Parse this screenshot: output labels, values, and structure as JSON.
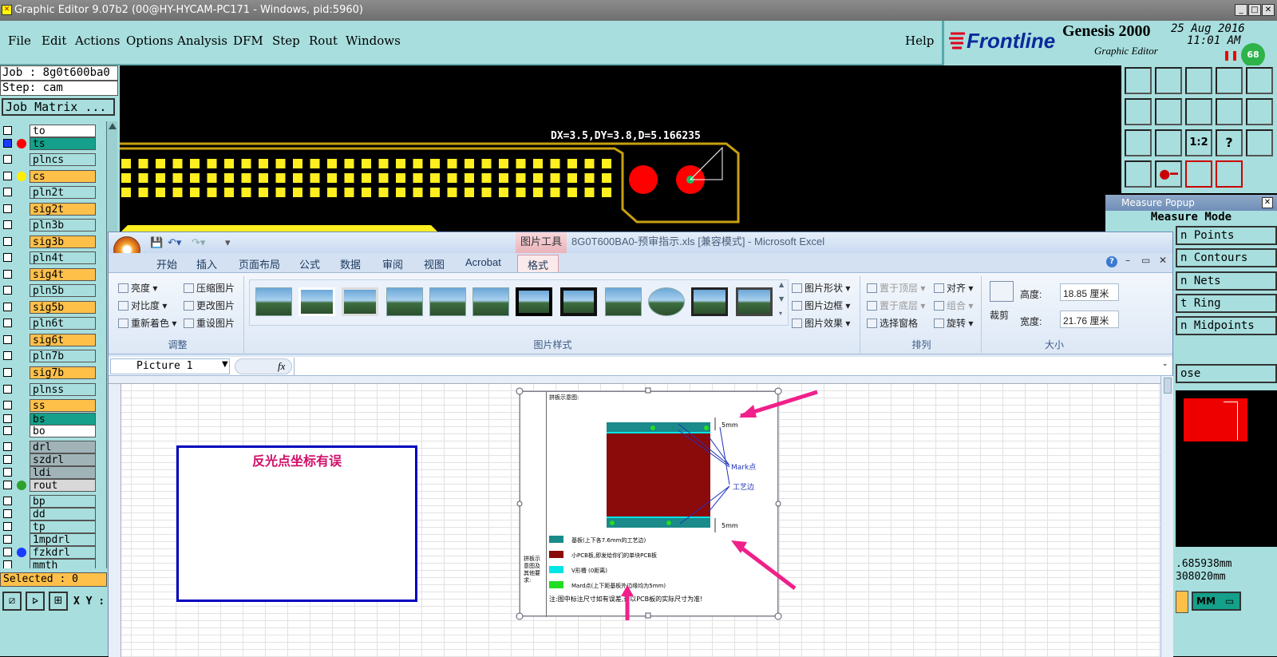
{
  "genesis": {
    "window_title": "Graphic Editor 9.07b2 (00@HY-HYCAM-PC171 - Windows, pid:5960)",
    "menu": [
      "File",
      "Edit",
      "Actions",
      "Options",
      "Analysis",
      "DFM",
      "Step",
      "Rout",
      "Windows"
    ],
    "help": "Help",
    "brand": "Frontline",
    "product": "Genesis 2000",
    "subtitle": "Graphic Editor",
    "date": "25 Aug 2016",
    "time": "11:01 AM",
    "badge": "68",
    "job": "Job : 8g0t600ba0",
    "step": "Step: cam",
    "job_matrix": "Job Matrix ...",
    "layers": [
      {
        "name": "to",
        "bg": "#ffffff",
        "dot": ""
      },
      {
        "name": "ts",
        "bg": "#14a08a",
        "dot": "#ff0000",
        "sel": true
      },
      {
        "name": "plncs",
        "bg": "#a8dede",
        "dot": ""
      },
      {
        "name": "cs",
        "bg": "#ffc04a",
        "dot": "#ffee00"
      },
      {
        "name": "pln2t",
        "bg": "#a8dede",
        "dot": ""
      },
      {
        "name": "sig2t",
        "bg": "#ffc04a",
        "dot": ""
      },
      {
        "name": "pln3b",
        "bg": "#a8dede",
        "dot": ""
      },
      {
        "name": "sig3b",
        "bg": "#ffc04a",
        "dot": ""
      },
      {
        "name": "pln4t",
        "bg": "#a8dede",
        "dot": ""
      },
      {
        "name": "sig4t",
        "bg": "#ffc04a",
        "dot": ""
      },
      {
        "name": "pln5b",
        "bg": "#a8dede",
        "dot": ""
      },
      {
        "name": "sig5b",
        "bg": "#ffc04a",
        "dot": ""
      },
      {
        "name": "pln6t",
        "bg": "#a8dede",
        "dot": ""
      },
      {
        "name": "sig6t",
        "bg": "#ffc04a",
        "dot": ""
      },
      {
        "name": "pln7b",
        "bg": "#a8dede",
        "dot": ""
      },
      {
        "name": "sig7b",
        "bg": "#ffc04a",
        "dot": ""
      },
      {
        "name": "plnss",
        "bg": "#a8dede",
        "dot": ""
      },
      {
        "name": "ss",
        "bg": "#ffc04a",
        "dot": ""
      },
      {
        "name": "bs",
        "bg": "#14a08a",
        "dot": ""
      },
      {
        "name": "bo",
        "bg": "#ffffff",
        "dot": ""
      },
      {
        "name": "drl",
        "bg": "#a0b4b8",
        "dot": ""
      },
      {
        "name": "szdrl",
        "bg": "#a0b4b8",
        "dot": ""
      },
      {
        "name": "ldi",
        "bg": "#a0b4b8",
        "dot": ""
      },
      {
        "name": "rout",
        "bg": "#d8d8d8",
        "dot": "#2ea02e"
      },
      {
        "name": "bp",
        "bg": "#a8dede",
        "dot": ""
      },
      {
        "name": "dd",
        "bg": "#a8dede",
        "dot": ""
      },
      {
        "name": "tp",
        "bg": "#a8dede",
        "dot": ""
      },
      {
        "name": "1mpdrl",
        "bg": "#a8dede",
        "dot": ""
      },
      {
        "name": "fzkdrl",
        "bg": "#a8dede",
        "dot": "#1a3cff"
      },
      {
        "name": "mmth",
        "bg": "#a8dede",
        "dot": ""
      }
    ],
    "selected": "Selected : 0",
    "xy_label": "X Y :",
    "measure_readout": "DX=3.5,DY=3.8,D=5.166235",
    "measure_popup": {
      "title": "Measure Popup",
      "mode": "Measure Mode",
      "buttons": [
        "n Points",
        "n Contours",
        "n Nets",
        "t Ring",
        "n Midpoints"
      ],
      "close": "ose",
      "val1": ".685938mm",
      "val2": "308020mm",
      "unit": "MM"
    }
  },
  "excel": {
    "title": "8G0T600BA0-预审指示.xls  [兼容模式] - Microsoft Excel",
    "context_tab": "图片工具",
    "tabs": [
      "开始",
      "插入",
      "页面布局",
      "公式",
      "数据",
      "审阅",
      "视图",
      "Acrobat",
      "格式"
    ],
    "adjust": {
      "items": [
        "亮度",
        "对比度",
        "重新着色",
        "压缩图片",
        "更改图片",
        "重设图片"
      ],
      "label": "调整"
    },
    "styles_label": "图片样式",
    "shape_items": [
      "图片形状",
      "图片边框",
      "图片效果"
    ],
    "arrange": {
      "items": [
        "置于顶层",
        "置于底层",
        "选择窗格",
        "对齐",
        "组合",
        "旋转"
      ],
      "label": "排列"
    },
    "size": {
      "crop": "裁剪",
      "height_label": "高度:",
      "height": "18.85 厘米",
      "width_label": "宽度:",
      "width": "21.76 厘米",
      "label": "大小"
    },
    "namebox": "Picture 1",
    "fx": "fx",
    "textbox": "反光点坐标有误",
    "pic": {
      "header": "拼板示意图:",
      "side": "拼板示意图及其他要求:",
      "dim_top": "5mm",
      "dim_bottom": "5mm",
      "mark": "Mark点",
      "edge": "工艺边",
      "legend": [
        {
          "color": "#1a8a8a",
          "text": "基板(上下各7.6mm的工艺边)"
        },
        {
          "color": "#8b0a0a",
          "text": "小PCB板,即发给你们的单块PCB板"
        },
        {
          "color": "#00e5e5",
          "text": "V形槽 (0距离)"
        },
        {
          "color": "#22dd22",
          "text": "Mard点(上下距基板外边缘均为5mm)"
        }
      ],
      "note": "注:图中标注尺寸如有误差,请以PCB板的实际尺寸为准!"
    }
  }
}
